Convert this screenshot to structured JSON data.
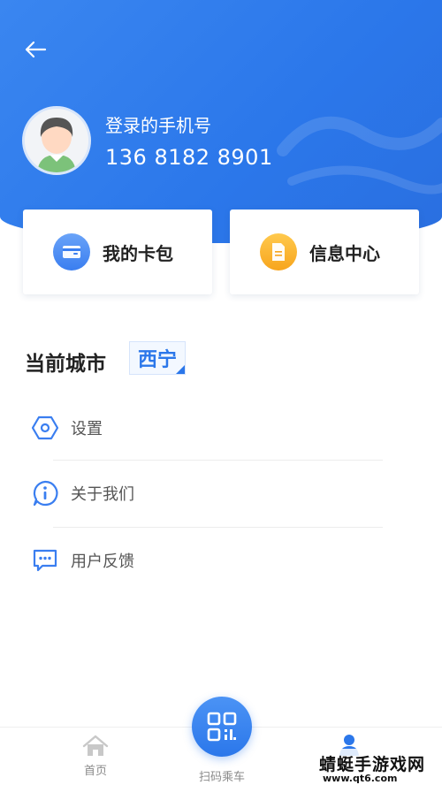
{
  "header": {
    "phone_label": "登录的手机号",
    "phone_number": "136 8182 8901"
  },
  "cards": [
    {
      "label": "我的卡包",
      "icon": "wallet-icon"
    },
    {
      "label": "信息中心",
      "icon": "document-icon"
    }
  ],
  "city": {
    "label": "当前城市",
    "value": "西宁"
  },
  "menu": [
    {
      "label": "设置",
      "icon": "settings-icon"
    },
    {
      "label": "关于我们",
      "icon": "info-icon"
    },
    {
      "label": "用户反馈",
      "icon": "feedback-icon"
    }
  ],
  "tabbar": {
    "home_label": "首页",
    "scan_label": "扫码乘车"
  },
  "watermark": {
    "title": "蜻蜓手游戏网",
    "url": "www.qt6.com"
  },
  "colors": {
    "primary": "#2b77ea",
    "orange": "#f7a51d"
  }
}
